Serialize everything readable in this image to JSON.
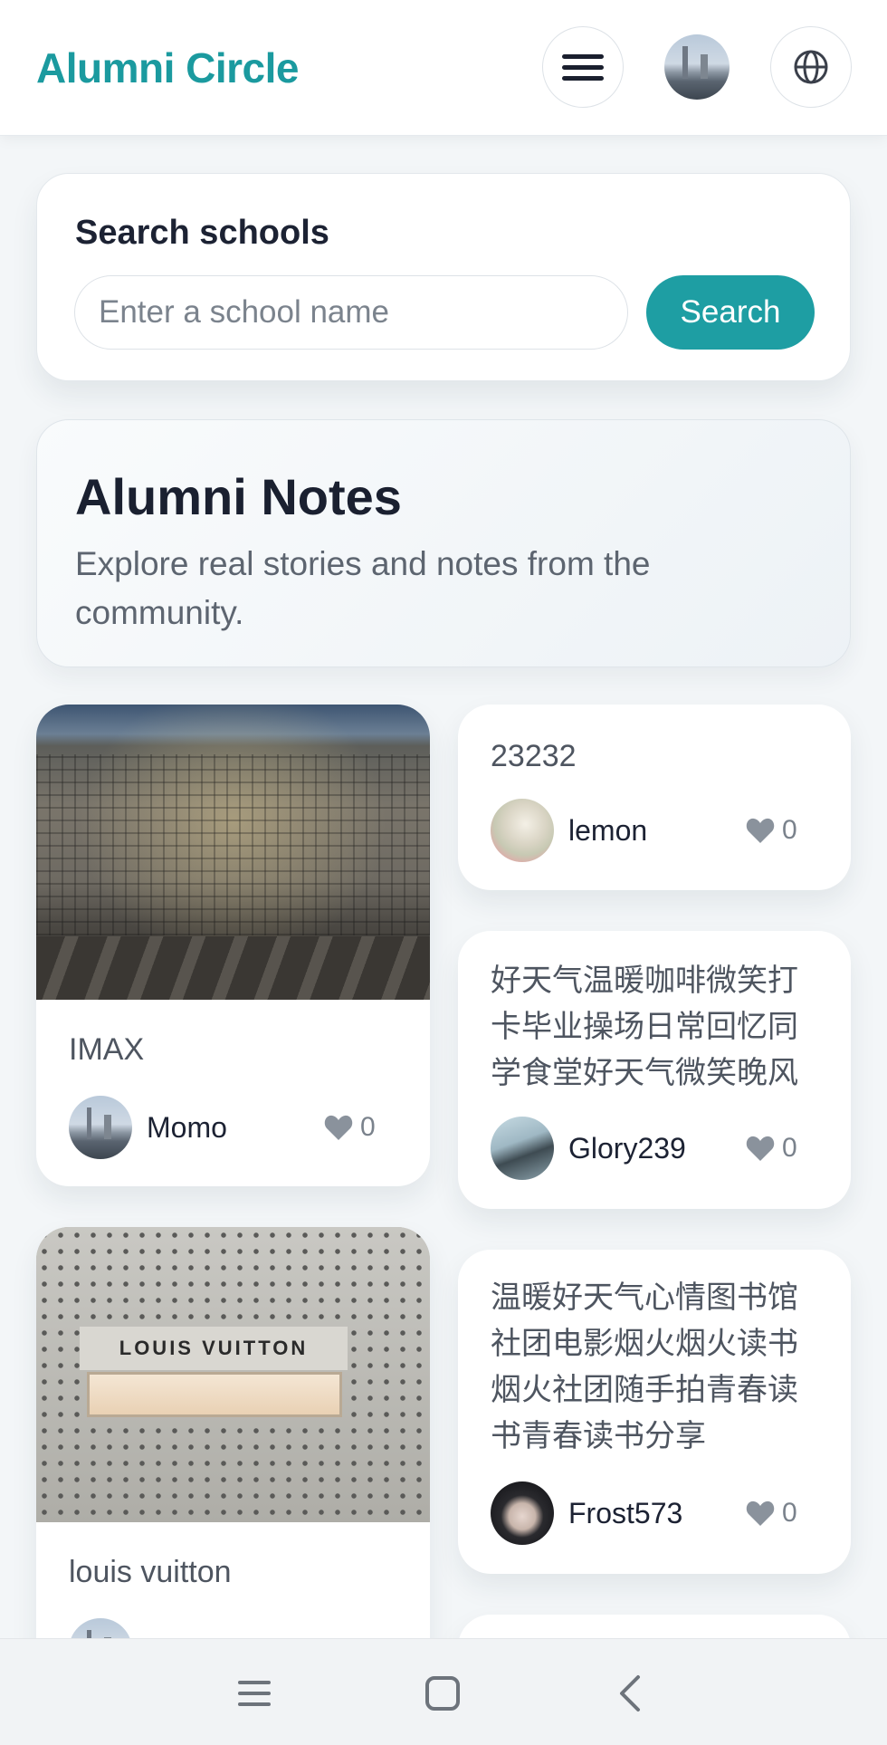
{
  "header": {
    "brand": "Alumni Circle",
    "menu_icon": "hamburger-menu-icon",
    "avatar_icon": "user-avatar",
    "language_icon": "globe-icon"
  },
  "search": {
    "title": "Search schools",
    "placeholder": "Enter a school name",
    "value": "",
    "button": "Search"
  },
  "hero": {
    "title": "Alumni Notes",
    "subtitle": "Explore real stories and notes from the community."
  },
  "notes": {
    "left": [
      {
        "title": "IMAX",
        "author": "Momo",
        "likes": "0",
        "image": "photo-imax-installation"
      },
      {
        "title": "louis vuitton",
        "author": "",
        "likes": "",
        "image": "photo-louis-vuitton-store"
      }
    ],
    "right": [
      {
        "text": "23232",
        "author": "lemon",
        "likes": "0"
      },
      {
        "text": "好天气温暖咖啡微笑打卡毕业操场日常回忆同学食堂好天气微笑晚风",
        "author": "Glory239",
        "likes": "0"
      },
      {
        "text": "温暖好天气心情图书馆社团电影烟火烟火读书烟火社团随手拍青春读书青春读书分享",
        "author": "Frost573",
        "likes": "0"
      }
    ]
  },
  "colors": {
    "accent": "#1e9ea3",
    "brand_text": "#1b9a9f",
    "page_bg": "#f3f6f8"
  },
  "system_nav": {
    "icons": [
      "recent-apps-icon",
      "home-icon",
      "back-icon"
    ]
  }
}
